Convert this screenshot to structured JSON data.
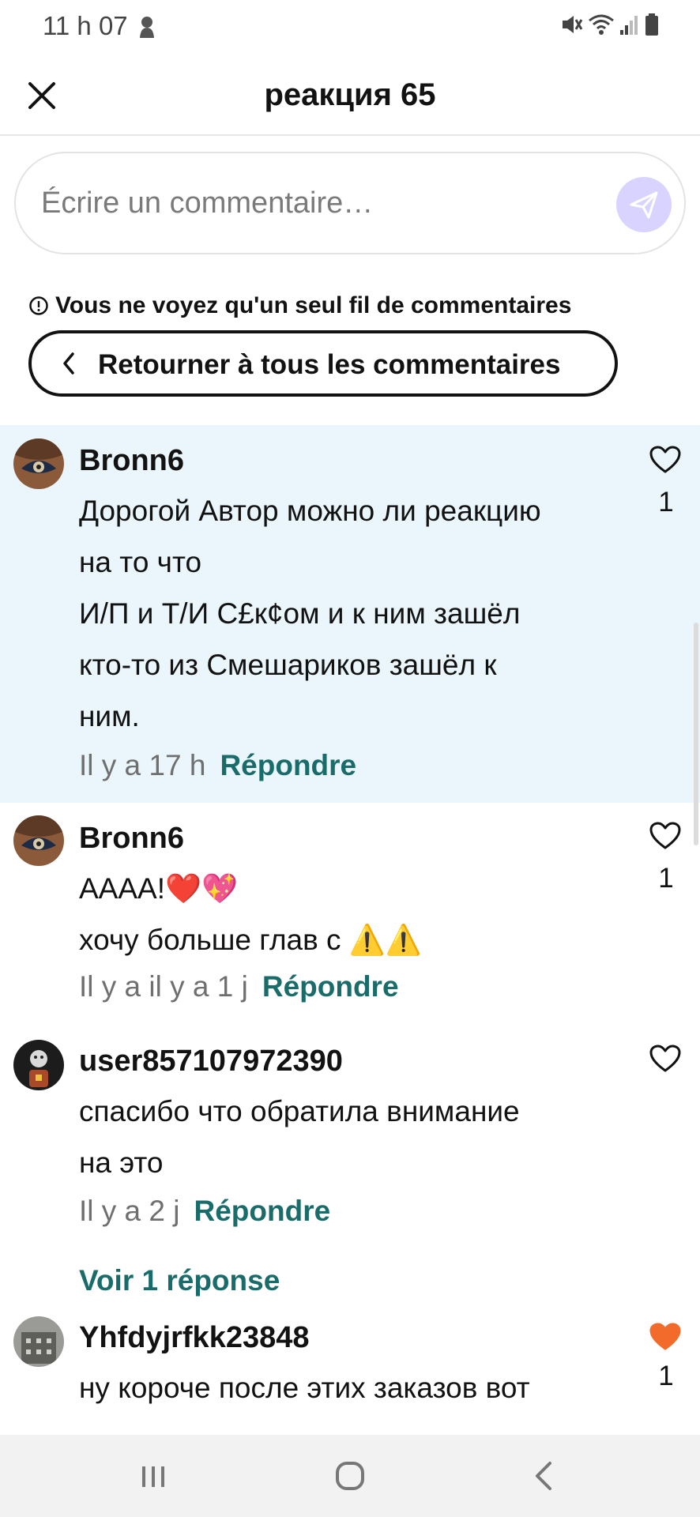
{
  "status_bar": {
    "time": "11 h 07"
  },
  "header": {
    "title": "реакция 65"
  },
  "comment_input": {
    "placeholder": "Écrire un commentaire…"
  },
  "thread_notice": "Vous ne voyez qu'un seul fil de commentaires",
  "back_button_label": "Retourner à tous les commentaires",
  "comments": [
    {
      "username": "Bronn6",
      "lines": [
        "Дорогой Автор можно ли реакцию",
        "на то что",
        " И/П и Т/И  С£к¢ом и к ним зашёл",
        "кто-то из Смешариков зашёл к",
        "ним."
      ],
      "time": "Il y a 17 h",
      "reply_label": "Répondre",
      "likes": "1",
      "liked": false
    },
    {
      "username": "Bronn6",
      "lines": [
        "АААА!❤️💖",
        "хочу больше глав с ⚠️⚠️"
      ],
      "time": "Il y a il y a 1 j",
      "reply_label": "Répondre",
      "likes": "1",
      "liked": false
    },
    {
      "username": "user857107972390",
      "lines": [
        "спасибо что обратила внимание",
        "на это"
      ],
      "time": "Il y a 2 j",
      "reply_label": "Répondre",
      "likes": "",
      "liked": false,
      "view_replies": "Voir 1 réponse"
    },
    {
      "username": "Yhfdyjrfkk23848",
      "lines": [
        "ну короче после этих заказов вот"
      ],
      "likes": "1",
      "liked": true
    }
  ],
  "colors": {
    "accent_teal": "#1a6c6b",
    "liked_heart": "#f26b2a",
    "highlight_bg": "#eaf6fb",
    "send_button": "#d9d4ff"
  }
}
